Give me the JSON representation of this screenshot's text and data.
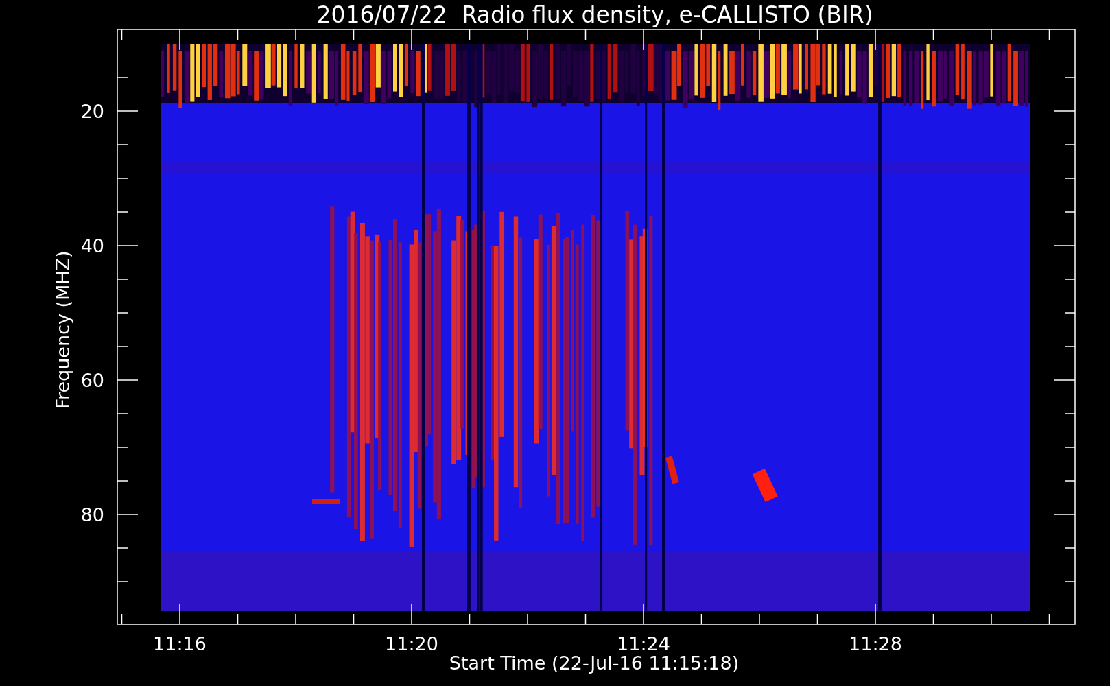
{
  "title": "2016/07/22  Radio flux density, e-CALLISTO (BIR)",
  "plot": {
    "ylabel": "Frequency (MHZ)",
    "xlabel": "Start Time (22-Jul-16 11:15:18)",
    "yticks": [
      "20",
      "40",
      "60",
      "80"
    ],
    "xticks": [
      "11:16",
      "11:20",
      "11:24",
      "11:28"
    ]
  }
}
